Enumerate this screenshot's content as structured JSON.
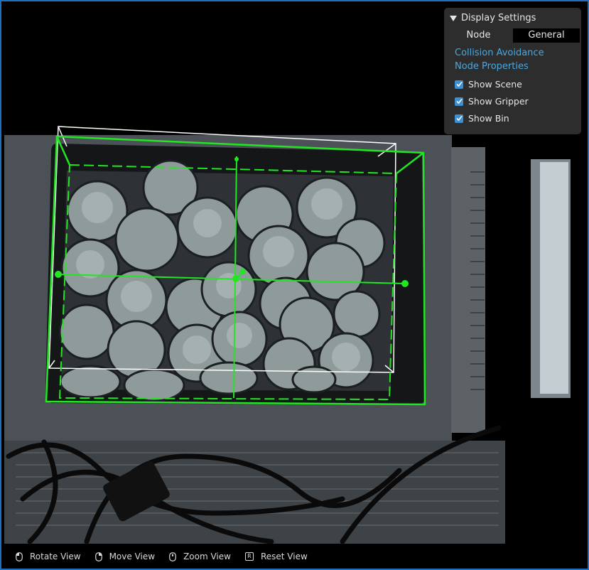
{
  "settings": {
    "title": "Display Settings",
    "tabs": [
      {
        "label": "Node"
      },
      {
        "label": "General"
      }
    ],
    "links": [
      {
        "label": "Collision Avoidance"
      },
      {
        "label": "Node Properties"
      }
    ],
    "checkboxes": [
      {
        "label": "Show Scene",
        "checked": true
      },
      {
        "label": "Show Gripper",
        "checked": true
      },
      {
        "label": "Show Bin",
        "checked": true
      }
    ]
  },
  "toolbar": {
    "rotate_label": "Rotate View",
    "move_label": "Move View",
    "zoom_label": "Zoom View",
    "reset_label": "Reset View",
    "reset_key": "R"
  },
  "colors": {
    "frame_border": "#1f6fbf",
    "overlay_green": "#22e622",
    "overlay_white": "#ffffff",
    "link_blue": "#4aa8e0",
    "checkbox_blue": "#3d8fd0",
    "panel_bg": "#2d2d2d"
  }
}
